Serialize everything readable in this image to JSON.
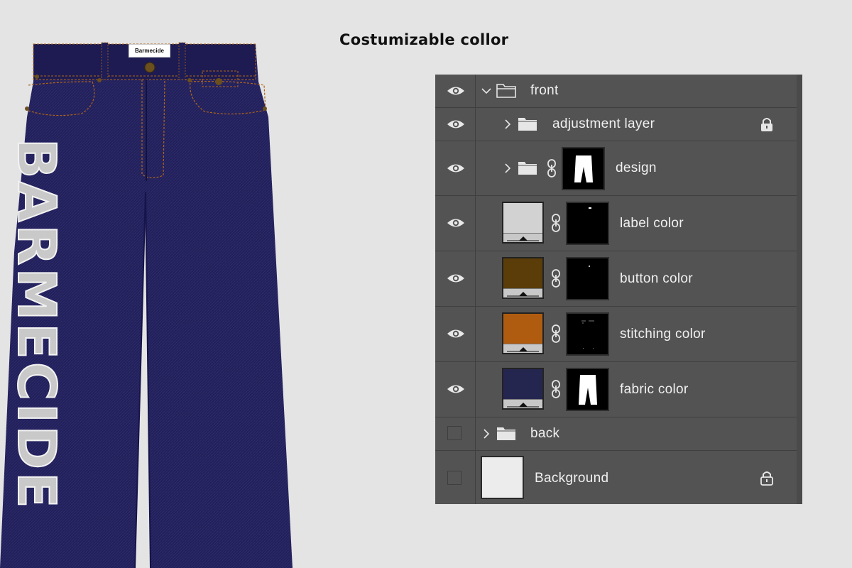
{
  "headline": "Costumizable collor",
  "garment": {
    "label_text": "Barmecide",
    "side_print": "BARMECIDE",
    "fabric_color": "#22205a",
    "stitching_color": "#b0651a",
    "button_color": "#5b3f13",
    "label_color": "#d0d0d0"
  },
  "layers_panel": {
    "layers": [
      {
        "name": "front",
        "visible": true,
        "type": "group",
        "expanded": true
      },
      {
        "name": "adjustment layer",
        "visible": true,
        "type": "group",
        "locked": true
      },
      {
        "name": "design",
        "visible": true,
        "type": "group",
        "has_mask": true
      },
      {
        "name": "label color",
        "visible": true,
        "type": "fill",
        "swatch": "#d2d2d2"
      },
      {
        "name": "button color",
        "visible": true,
        "type": "fill",
        "swatch": "#5a3d08"
      },
      {
        "name": "stitching color",
        "visible": true,
        "type": "fill",
        "swatch": "#b05c10"
      },
      {
        "name": "fabric color",
        "visible": true,
        "type": "fill",
        "swatch": "#252650"
      },
      {
        "name": "back",
        "visible": false,
        "type": "group"
      },
      {
        "name": "Background",
        "visible": false,
        "type": "background",
        "locked": true
      }
    ]
  }
}
